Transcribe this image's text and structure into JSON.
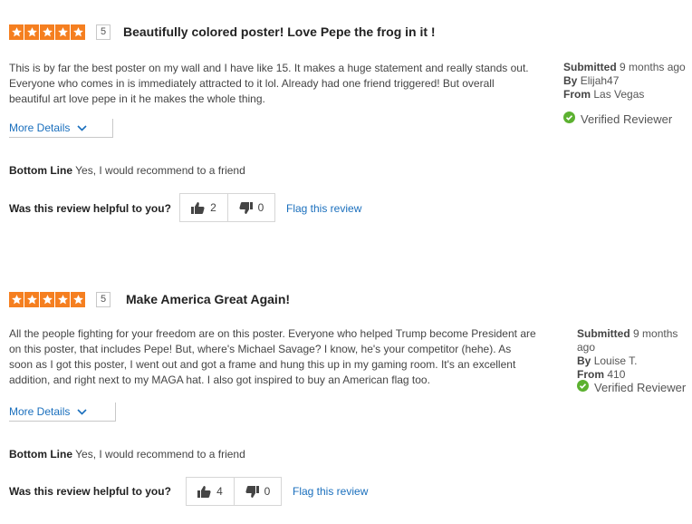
{
  "reviews": [
    {
      "rating": "5",
      "title": "Beautifully colored poster! Love Pepe the frog in it !",
      "body_lines": [
        "This is by far the best poster on my wall and I have like 15. It makes a huge statement and really stands out.",
        "Everyone who comes in is immediately attracted to it lol. Already had one friend triggered! But overall",
        "beautiful art love pepe in it he makes the whole thing."
      ],
      "more_details": "More Details",
      "bottom_line_label": "Bottom Line",
      "bottom_line_text": "Yes, I would recommend to a friend",
      "helpful_question": "Was this review helpful to you?",
      "upvotes": "2",
      "downvotes": "0",
      "flag": "Flag this review",
      "submitted_label": "Submitted",
      "submitted_value": "9 months ago",
      "by_label": "By",
      "by_value": "Elijah47",
      "from_label": "From",
      "from_value": "Las Vegas",
      "verified": "Verified Reviewer"
    },
    {
      "rating": "5",
      "title": "Make America Great Again!",
      "body_lines": [
        "All the people fighting for your freedom are on this poster. Everyone who helped Trump become President are",
        "on this poster, that includes Pepe! But, where's Michael Savage? I know, he's your competitor (hehe). As",
        "soon as I got this poster, I went out and got a frame and hung this up in my gaming room. It's an excellent",
        "addition, and right next to my MAGA hat. I also got inspired to buy an American flag too."
      ],
      "more_details": "More Details",
      "bottom_line_label": "Bottom Line",
      "bottom_line_text": "Yes, I would recommend to a friend",
      "helpful_question": "Was this review helpful to you?",
      "upvotes": "4",
      "downvotes": "0",
      "flag": "Flag this review",
      "submitted_label": "Submitted",
      "submitted_value": "9 months ago",
      "by_label": "By",
      "by_value": "Louise T.",
      "from_label": "From",
      "from_value": "410",
      "verified": "Verified Reviewer"
    }
  ],
  "colors": {
    "star": "#f57f20",
    "link": "#1a6fbd",
    "verified": "#5cb130"
  },
  "icons": {
    "star": "star-icon",
    "chevron": "chevron-down-icon",
    "thumbs_up": "thumbs-up-icon",
    "thumbs_down": "thumbs-down-icon",
    "verified": "check-circle-icon"
  }
}
